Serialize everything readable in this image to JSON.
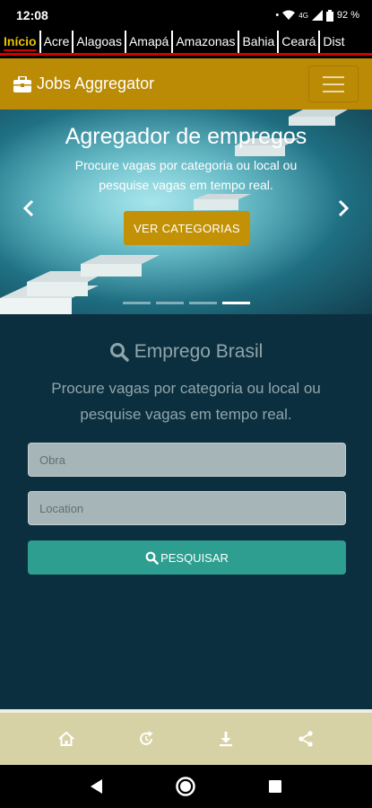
{
  "status_bar": {
    "time": "12:08",
    "network": "4G",
    "battery": "92 %"
  },
  "region_tabs": [
    {
      "label": "Início",
      "active": true
    },
    {
      "label": "Acre",
      "active": false
    },
    {
      "label": "Alagoas",
      "active": false
    },
    {
      "label": "Amapá",
      "active": false
    },
    {
      "label": "Amazonas",
      "active": false
    },
    {
      "label": "Bahia",
      "active": false
    },
    {
      "label": "Ceará",
      "active": false
    },
    {
      "label": "Dist",
      "active": false
    }
  ],
  "header": {
    "brand_icon": "briefcase-icon",
    "title": "Jobs Aggregator",
    "menu_icon": "hamburger-icon"
  },
  "hero": {
    "title": "Agregador de empregos",
    "subtitle": "Procure vagas por categoria ou local ou pesquise vagas em tempo real.",
    "cta_label": "VER CATEGORIAS",
    "slide_count": 4,
    "active_slide": 4
  },
  "search": {
    "heading": "Emprego Brasil",
    "description": "Procure vagas por categoria ou local ou pesquise vagas em tempo real.",
    "job_placeholder": "Obra",
    "location_placeholder": "Location",
    "button_label": "PESQUISAR"
  },
  "bottom_nav": [
    "home-icon",
    "refresh-icon",
    "download-icon",
    "share-icon"
  ],
  "colors": {
    "header_bg": "#bb8b06",
    "cta_bg": "#c29106",
    "section_bg": "#0c2f3f",
    "search_button_bg": "#2e9e90",
    "bottom_bar_bg": "#d7d2a6",
    "active_tab_text": "#e8c200",
    "tab_accent": "#d40000"
  }
}
